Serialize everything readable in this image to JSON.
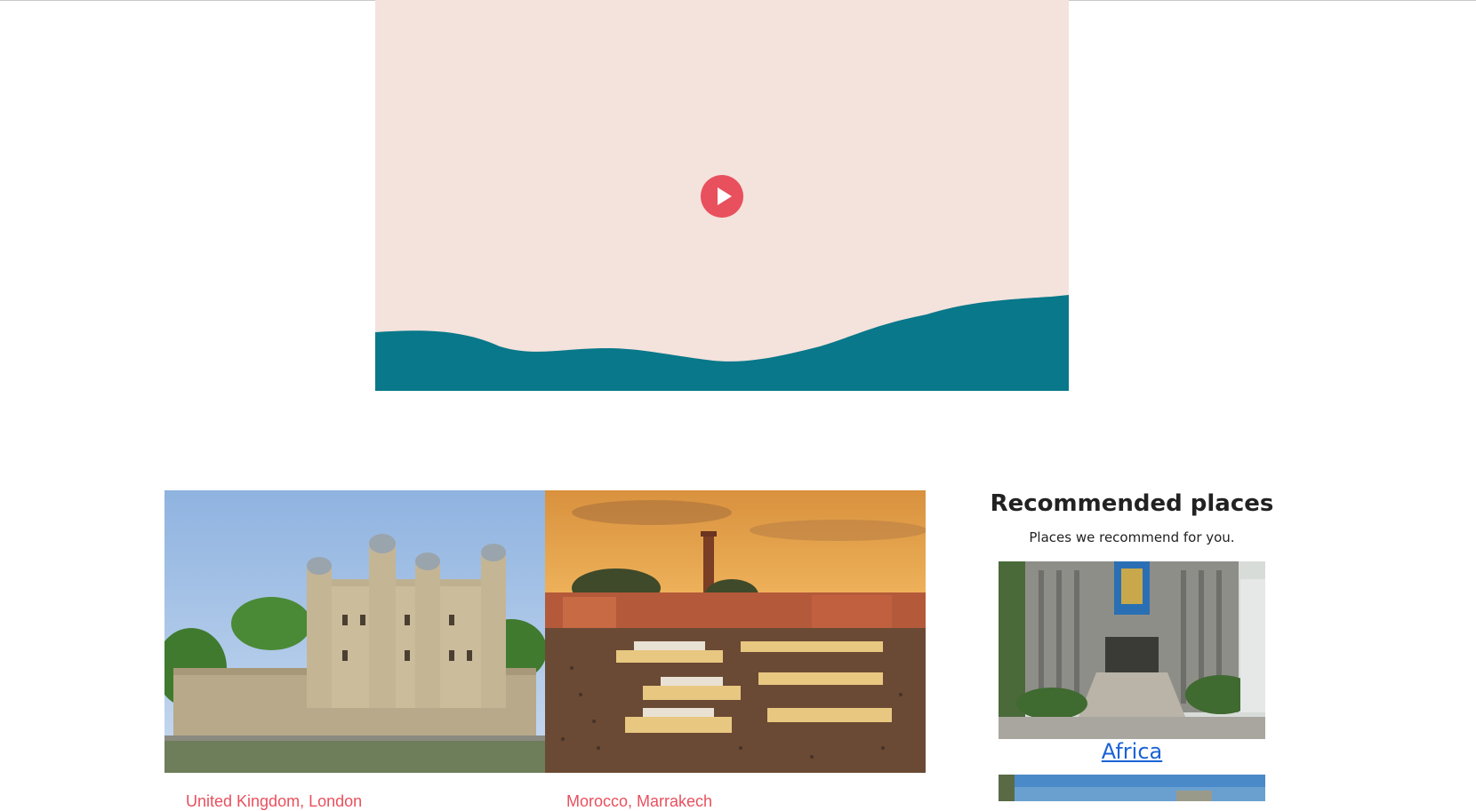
{
  "video": {
    "play_label": "Play video",
    "colors": {
      "background": "#f4e2dc",
      "hills": "#08788a",
      "play": "#e8505e"
    }
  },
  "gallery": {
    "cards": [
      {
        "caption": "United Kingdom, London",
        "photo": "tower-of-london-photo"
      },
      {
        "caption": "Morocco, Marrakech",
        "photo": "marrakech-square-photo"
      }
    ]
  },
  "recommended": {
    "title": "Recommended places",
    "subtitle": "Places we recommend for you.",
    "items": [
      {
        "label": "Africa",
        "photo": "africa-building-photo"
      },
      {
        "label": "",
        "photo": "next-place-photo"
      }
    ]
  }
}
